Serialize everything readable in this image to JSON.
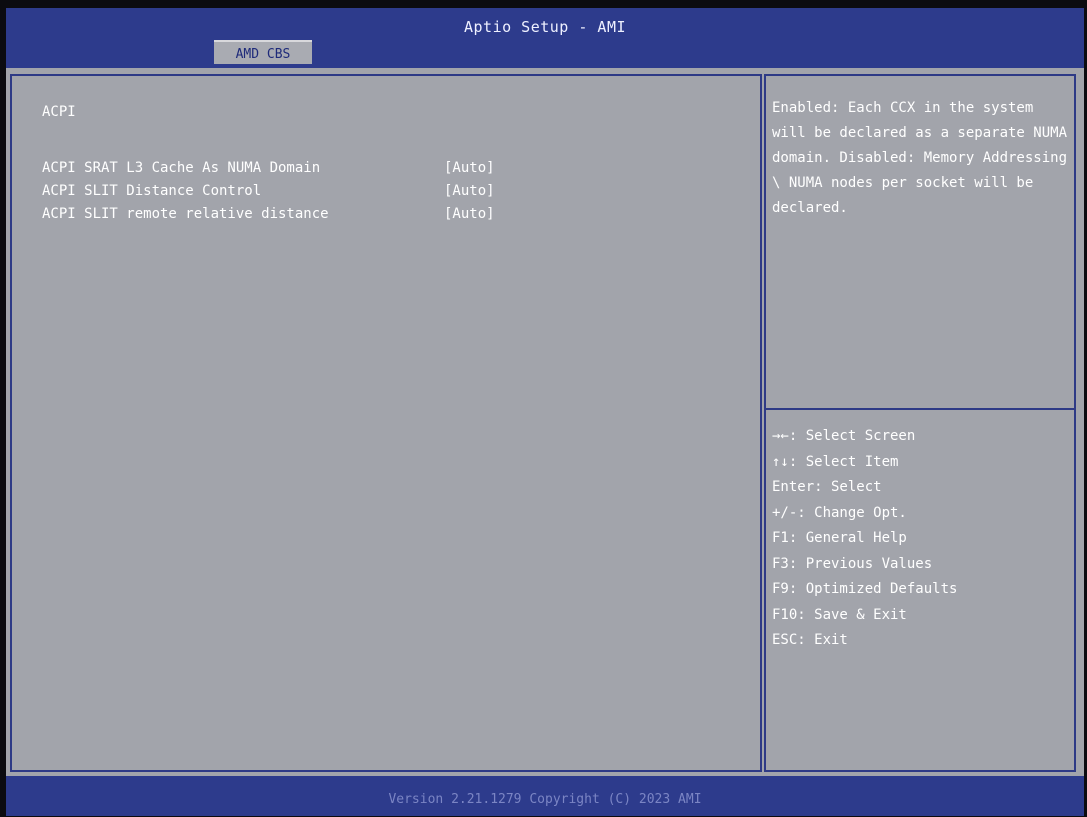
{
  "header": {
    "title": "Aptio Setup - AMI",
    "active_tab": "AMD CBS"
  },
  "main": {
    "section_title": "ACPI",
    "settings": [
      {
        "label": "ACPI SRAT L3 Cache As NUMA Domain",
        "value": "[Auto]"
      },
      {
        "label": "ACPI SLIT Distance Control",
        "value": "[Auto]"
      },
      {
        "label": "ACPI SLIT remote relative distance",
        "value": "[Auto]"
      }
    ]
  },
  "help": {
    "text": "Enabled: Each CCX in the system will be declared as a separate NUMA domain. Disabled: Memory Addressing \\ NUMA nodes per socket will be declared.",
    "keys": [
      "→←: Select Screen",
      "↑↓: Select Item",
      "Enter: Select",
      "+/-: Change Opt.",
      "F1: General Help",
      "F3: Previous Values",
      "F9: Optimized Defaults",
      "F10: Save & Exit",
      "ESC: Exit"
    ]
  },
  "footer": {
    "version": "Version 2.21.1279 Copyright (C) 2023 AMI"
  },
  "colors": {
    "header_bg": "#2d3b8c",
    "panel_bg": "#a2a4ab",
    "text": "#ffffff",
    "value": "#ffffff"
  }
}
